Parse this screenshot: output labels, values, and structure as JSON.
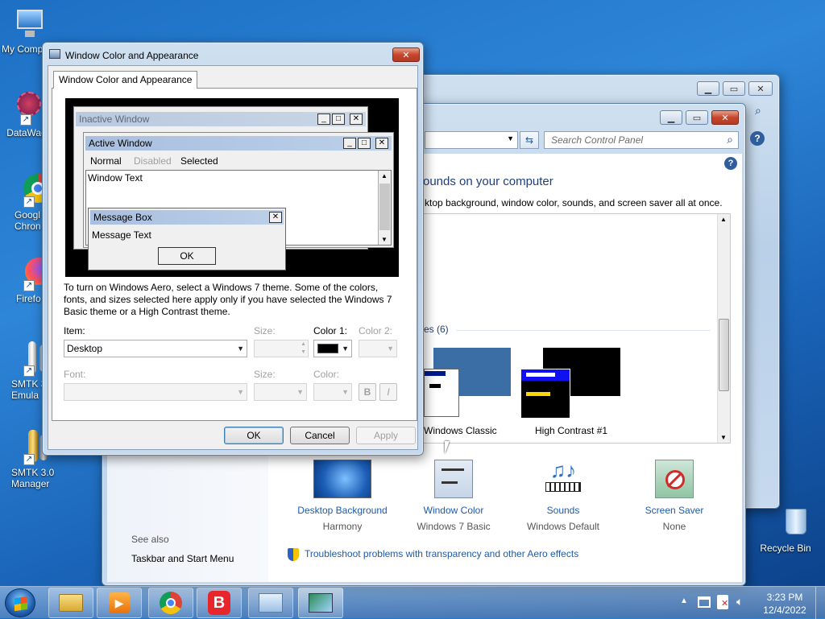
{
  "desktop": {
    "icons": [
      {
        "label": "My Comp"
      },
      {
        "label": "DataWag"
      },
      {
        "label": "Googl\nChron"
      },
      {
        "label": "Firefo"
      },
      {
        "label": "SMTK 3\nEmula"
      },
      {
        "label": "SMTK 3.0\nManager"
      },
      {
        "label": "Recycle Bin"
      }
    ]
  },
  "control_panel": {
    "search_placeholder": "Search Control Panel",
    "heading": "ounds on your computer",
    "description": "ktop background, window color, sounds, and screen saver all at once.",
    "themes_group": "es (6)",
    "themes": [
      {
        "name": "Windows Classic"
      },
      {
        "name": "High Contrast #1"
      }
    ],
    "settings": [
      {
        "title": "Desktop Background",
        "value": "Harmony"
      },
      {
        "title": "Window Color",
        "value": "Windows 7 Basic"
      },
      {
        "title": "Sounds",
        "value": "Windows Default"
      },
      {
        "title": "Screen Saver",
        "value": "None"
      }
    ],
    "see_also": "See also",
    "taskbar_link": "Taskbar and Start Menu",
    "troubleshoot_link": "Troubleshoot problems with transparency and other Aero effects"
  },
  "dialog": {
    "title": "Window Color and Appearance",
    "tab": "Window Color and Appearance",
    "preview": {
      "inactive_title": "Inactive Window",
      "active_title": "Active Window",
      "menu": [
        "Normal",
        "Disabled",
        "Selected"
      ],
      "window_text": "Window Text",
      "msgbox_title": "Message Box",
      "msgbox_text": "Message Text",
      "msgbox_ok": "OK"
    },
    "info_text": "To turn on Windows Aero, select a Windows 7 theme.  Some of the colors, fonts, and sizes selected here apply only if you have selected the Windows 7 Basic theme or a High Contrast theme.",
    "item_label": "Item:",
    "item_value": "Desktop",
    "size_label": "Size:",
    "color1_label": "Color 1:",
    "color2_label": "Color 2:",
    "font_label": "Font:",
    "size2_label": "Size:",
    "color_label": "Color:",
    "bold": "B",
    "italic": "I",
    "ok": "OK",
    "cancel": "Cancel",
    "apply": "Apply"
  },
  "taskbar": {
    "time": "3:23 PM",
    "date": "12/4/2022"
  },
  "colors": {
    "accent_link": "#1e5aa8",
    "classic_blue": "#3a6ea5",
    "high_contrast_black": "#000000"
  }
}
